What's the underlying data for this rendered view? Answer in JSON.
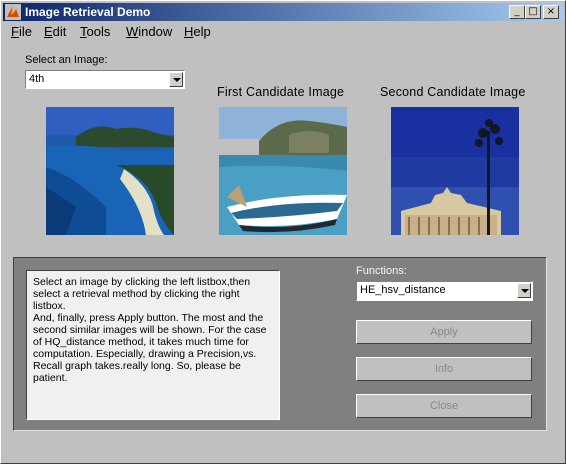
{
  "window": {
    "title": "Image Retrieval Demo",
    "controls": {
      "minimize": "_",
      "maximize": "□",
      "close": "×"
    }
  },
  "menu": [
    {
      "label": "File",
      "mnemonic": "F",
      "rest": "ile"
    },
    {
      "label": "Edit",
      "mnemonic": "E",
      "rest": "dit"
    },
    {
      "label": "Tools",
      "mnemonic": "T",
      "rest": "ools"
    },
    {
      "label": "Window",
      "mnemonic": "W",
      "rest": "indow"
    },
    {
      "label": "Help",
      "mnemonic": "H",
      "rest": "elp"
    }
  ],
  "image_select": {
    "label": "Select an Image:",
    "value": "4th"
  },
  "headings": {
    "first": "First Candidate Image",
    "second": "Second Candidate Image"
  },
  "description": "Select an image by clicking the left listbox,then\nselect a retrieval method by clicking the right listbox.\nAnd, finally, press Apply button. The most and the\nsecond similar images will be shown.   For the case\nof HQ_distance method, it takes much time for\ncomputation. Especially, drawing a Precision,vs.\nRecall graph takes.really long. So, please be\npatient.",
  "functions": {
    "label": "Functions:",
    "value": "HE_hsv_distance"
  },
  "buttons": {
    "apply": "Apply",
    "info": "Info",
    "close": "Close"
  },
  "colors": {
    "titlebar_start": "#0a246a",
    "titlebar_end": "#a6caf0",
    "panel": "#808080",
    "face": "#c0c0c0"
  }
}
